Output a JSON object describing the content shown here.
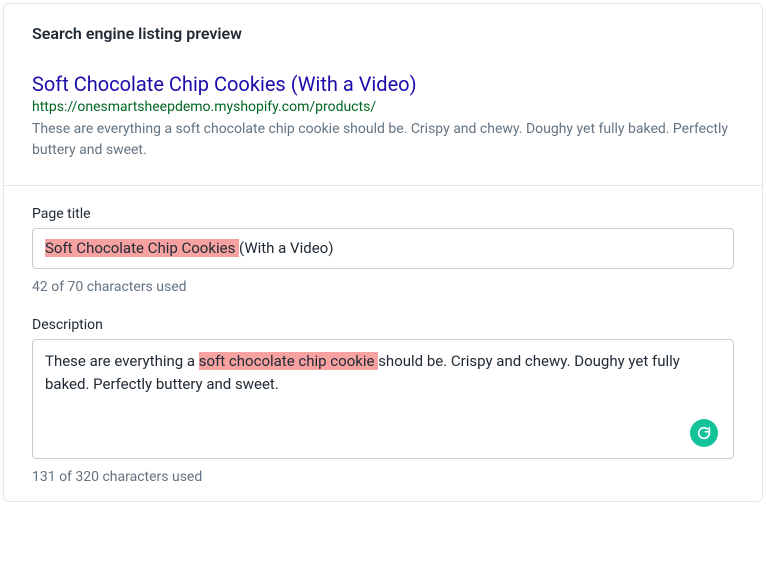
{
  "header": {
    "title": "Search engine listing preview"
  },
  "preview": {
    "title": "Soft Chocolate Chip Cookies (With a Video)",
    "url": "https://onesmartsheepdemo.myshopify.com/products/",
    "description": "These are everything a soft chocolate chip cookie should be. Crispy and chewy. Doughy yet fully baked. Perfectly buttery and sweet."
  },
  "form": {
    "page_title": {
      "label": "Page title",
      "value_parts": {
        "highlighted": "Soft Chocolate Chip Cookies ",
        "rest": "(With a Video)"
      },
      "counter": "42 of 70 characters used"
    },
    "description": {
      "label": "Description",
      "value_parts": {
        "before": "These are everything a ",
        "highlighted": "soft chocolate chip cookie ",
        "after": "should be. Crispy and chewy. Doughy yet fully baked. Perfectly buttery and sweet."
      },
      "counter": "131 of 320 characters used"
    }
  },
  "icons": {
    "grammarly": "grammarly-icon"
  }
}
